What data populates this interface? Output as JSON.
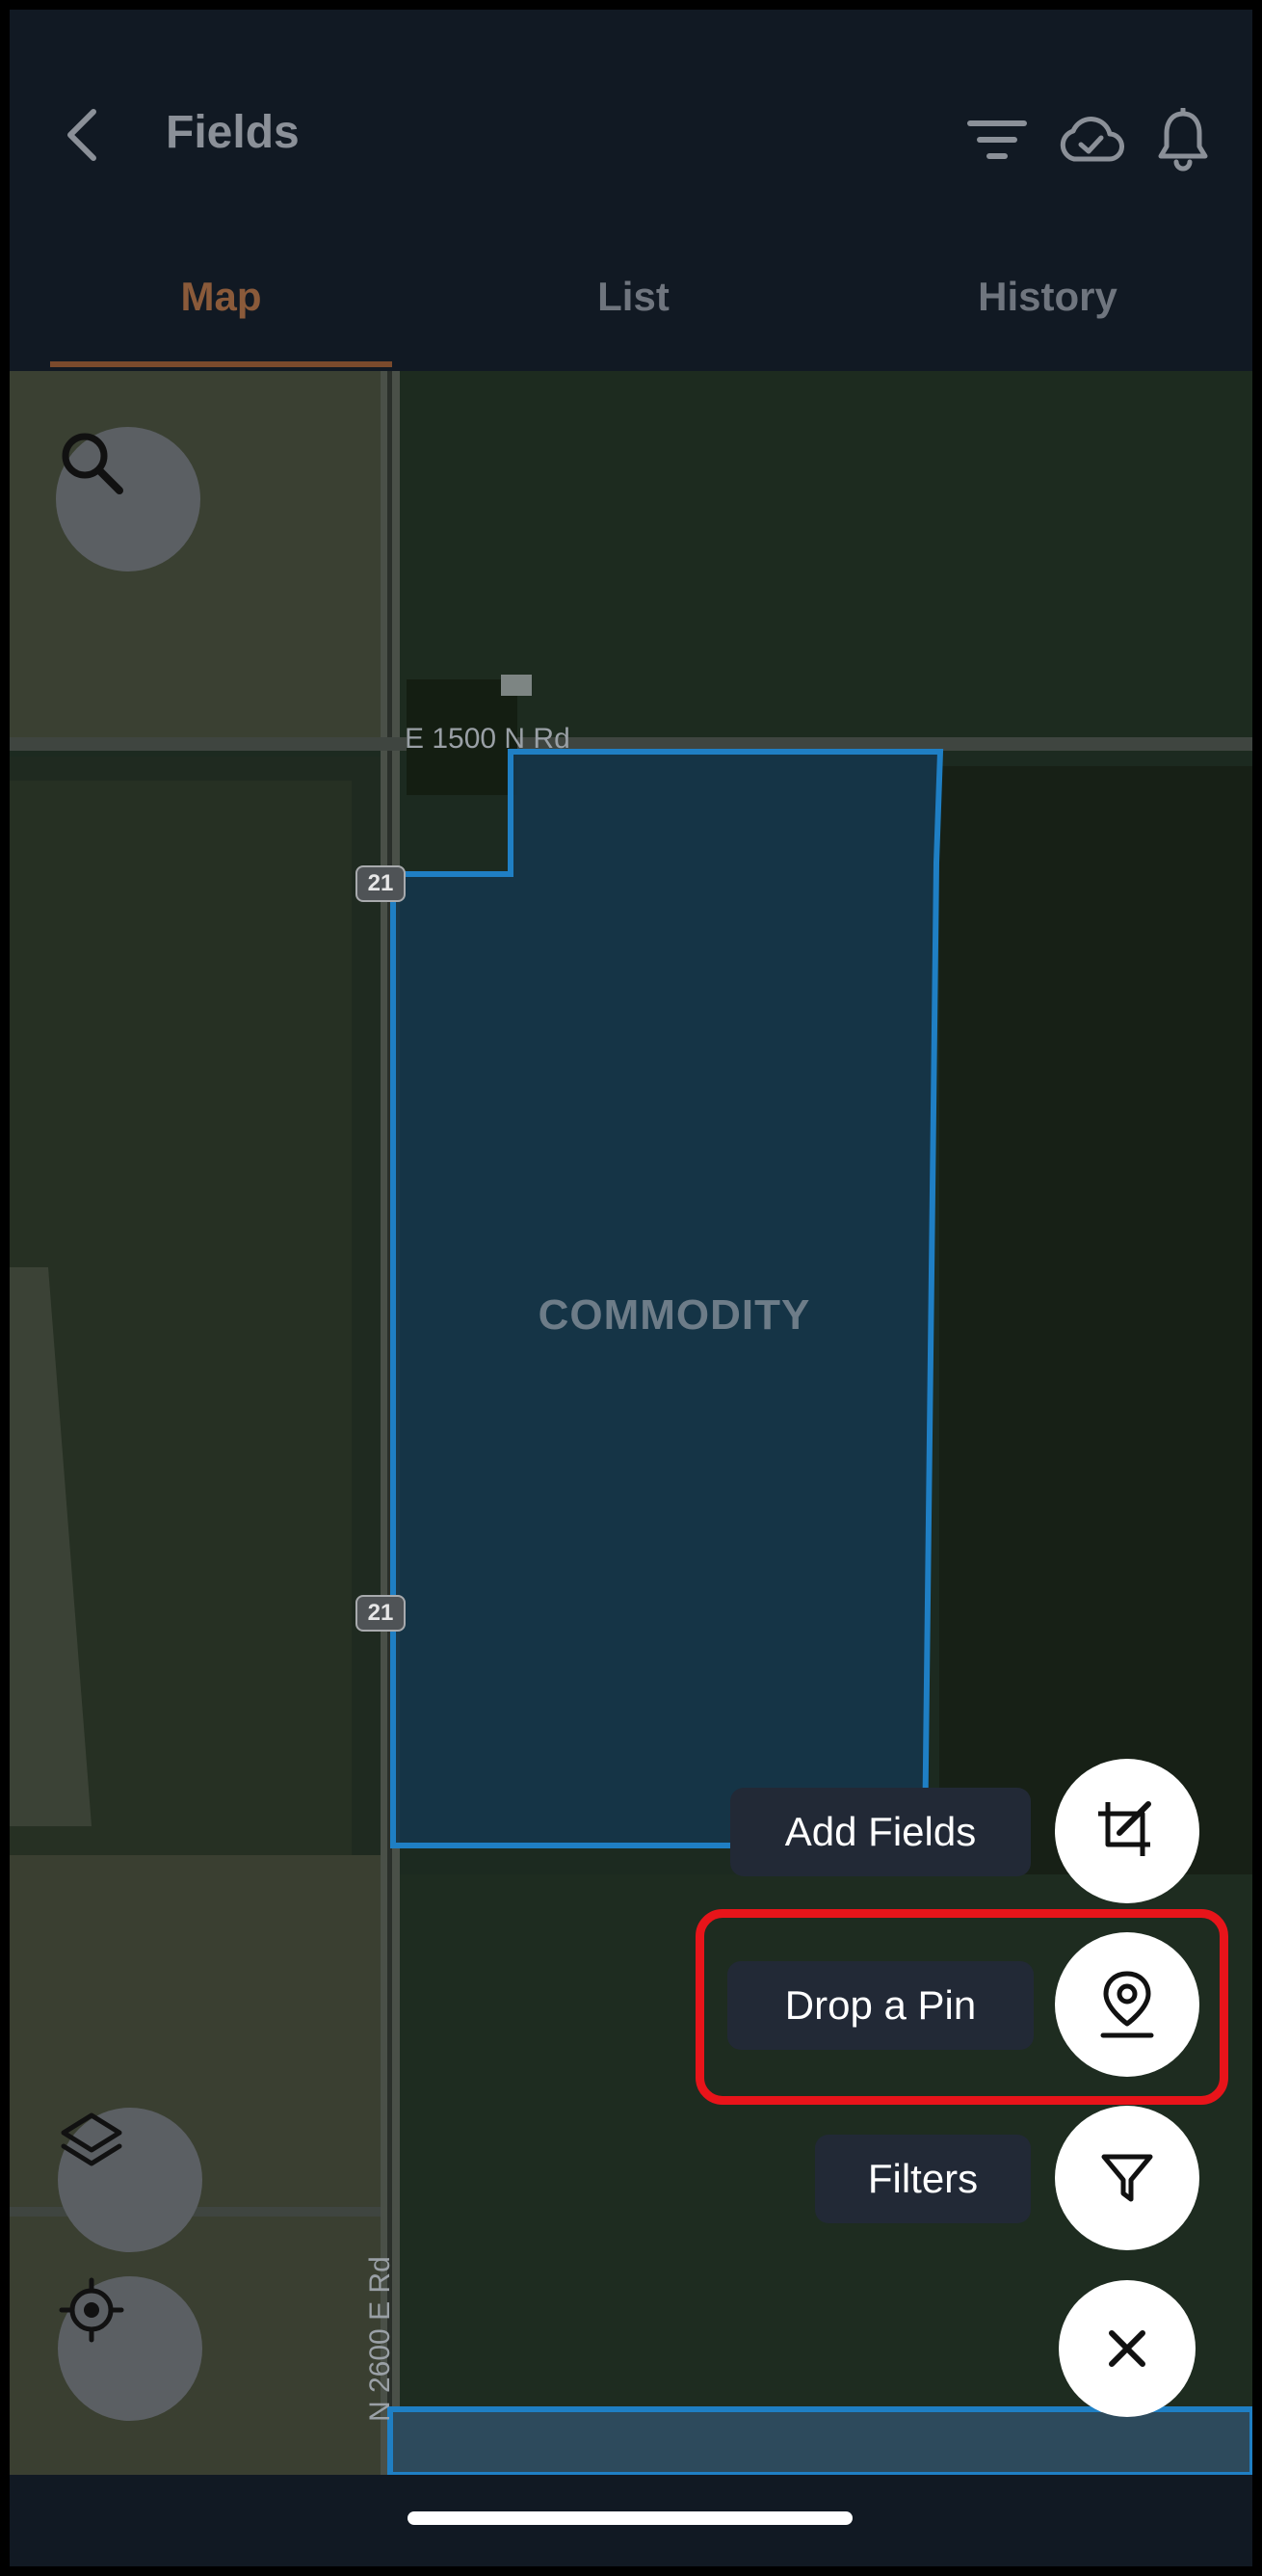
{
  "header": {
    "title": "Fields",
    "back_icon": "chevron-left-icon",
    "icons": [
      "filter-lines-icon",
      "cloud-check-icon",
      "bell-icon"
    ]
  },
  "tabs": [
    {
      "label": "Map",
      "active": true
    },
    {
      "label": "List",
      "active": false
    },
    {
      "label": "History",
      "active": false
    }
  ],
  "map": {
    "road_label_top": "E 1500 N Rd",
    "road_label_side": "N 2600 E Rd",
    "route_badge_1": "21",
    "route_badge_2": "21",
    "field_label": "COMMODITY",
    "search_icon": "search-icon",
    "layers_icon": "layers-icon",
    "locate_icon": "crosshair-icon"
  },
  "actions": {
    "add_fields": "Add Fields",
    "drop_pin": "Drop a Pin",
    "filters": "Filters",
    "close_icon": "close-icon"
  },
  "colors": {
    "accent_tab": "#8a5a3a",
    "field_outline": "#1f7fc4",
    "highlight": "#e8141a"
  }
}
